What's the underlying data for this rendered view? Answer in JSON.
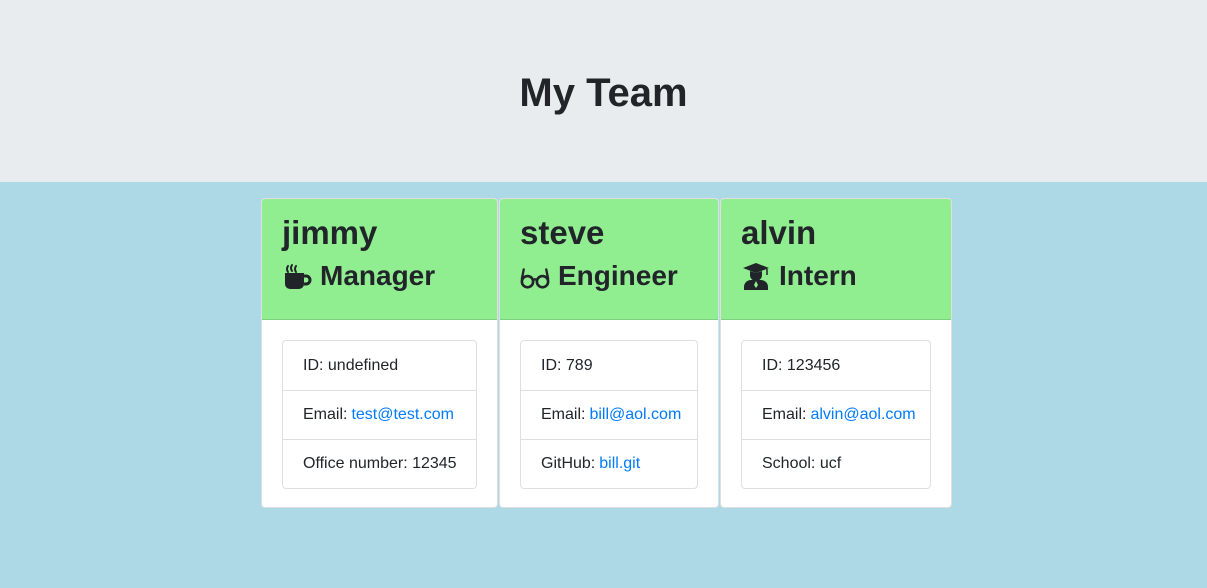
{
  "page": {
    "title": "My Team"
  },
  "team": [
    {
      "name": "jimmy",
      "role": "Manager",
      "icon": "coffee-mug-icon",
      "id_label": "ID: undefined",
      "email_label": "Email:",
      "email": "test@test.com",
      "extra_label": "Office number: 12345"
    },
    {
      "name": "steve",
      "role": "Engineer",
      "icon": "glasses-icon",
      "id_label": "ID: 789",
      "email_label": "Email:",
      "email": "bill@aol.com",
      "extra_label": "GitHub:",
      "extra_link": "bill.git"
    },
    {
      "name": "alvin",
      "role": "Intern",
      "icon": "graduate-icon",
      "id_label": "ID: 123456",
      "email_label": "Email:",
      "email": "alvin@aol.com",
      "extra_label": "School: ucf"
    }
  ],
  "colors": {
    "background": "#add8e6",
    "header_bg": "#e9ecef",
    "card_header": "#90ee90",
    "link": "#007bff"
  }
}
